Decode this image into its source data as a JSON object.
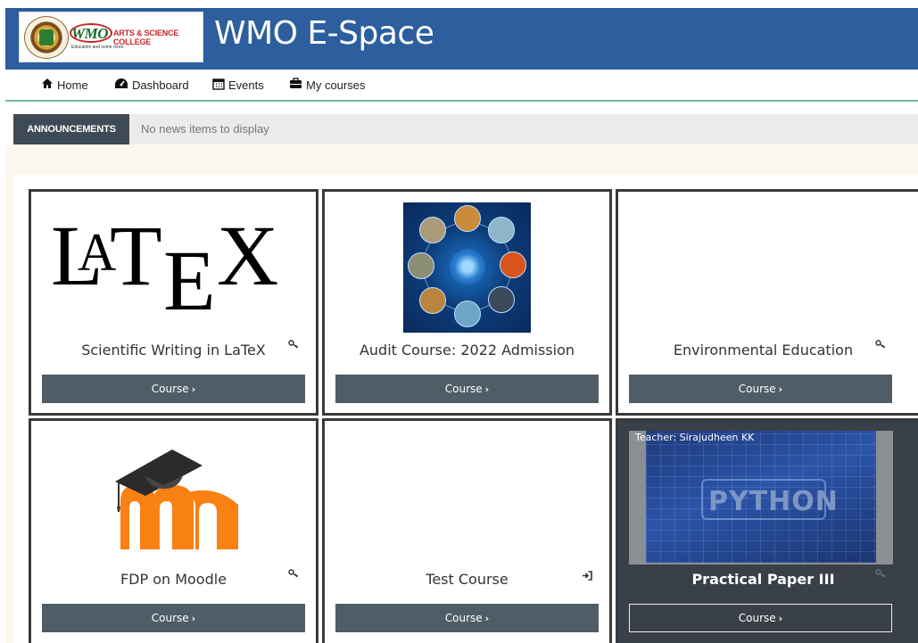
{
  "header": {
    "site_title": "WMO E-Space",
    "logo": {
      "name": "WMO",
      "college": "ARTS & SCIENCE COLLEGE",
      "tagline": "Education and some more"
    }
  },
  "nav": [
    {
      "label": "Home",
      "icon": "home-icon"
    },
    {
      "label": "Dashboard",
      "icon": "dashboard-icon"
    },
    {
      "label": "Events",
      "icon": "calendar-icon"
    },
    {
      "label": "My courses",
      "icon": "briefcase-icon"
    }
  ],
  "announcements": {
    "label": "ANNOUNCEMENTS",
    "text": "No news items to display"
  },
  "courses": [
    {
      "title": "Scientific Writing in LaTeX",
      "button": "Course",
      "icon": "key-icon",
      "image": "latex-logo"
    },
    {
      "title": "Audit Course: 2022 Admission",
      "button": "Course",
      "icon": "",
      "image": "audit-image"
    },
    {
      "title": "Environmental Education",
      "button": "Course",
      "icon": "key-icon",
      "image": ""
    },
    {
      "title": "FDP on Moodle",
      "button": "Course",
      "icon": "key-icon",
      "image": "moodle-logo"
    },
    {
      "title": "Test Course",
      "button": "Course",
      "icon": "sign-in-icon",
      "image": ""
    },
    {
      "title": "Practical Paper III",
      "button": "Course",
      "icon": "key-icon",
      "image": "python-image",
      "teacher": "Teacher: Sirajudheen KK",
      "image_text": "PYTHON"
    }
  ],
  "colors": {
    "header_bg": "#2d5e9e",
    "nav_border": "#6dbf9c",
    "button_bg": "#4f5d66",
    "card_border": "#3a3a3a",
    "announce_label_bg": "#3e4a55",
    "content_bg": "#fdf8ed"
  }
}
